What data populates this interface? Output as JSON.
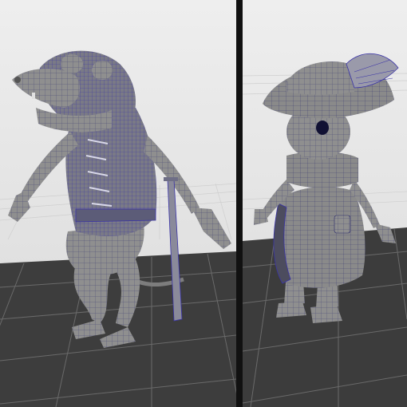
{
  "scene": {
    "divider_color": "#111111",
    "background_top": "#ececec",
    "background_bottom": "#dcdcdc",
    "floor_color": "#3c3c3c",
    "floor_grid_color": "#6a6a6a",
    "sky_grid_color": "#c9c9c9",
    "mesh_fill": "#8c8c8c",
    "mesh_shadow": "#6e6e6e",
    "wire_color": "#2b2b6b",
    "highlight_wire_color": "#4a3fb8"
  },
  "panels": [
    {
      "subject": "rat-warrior-model",
      "pose": "hunched-standing",
      "prop": "sword"
    },
    {
      "subject": "mouse-musketeer-model",
      "pose": "standing",
      "prop": "feathered-hat"
    }
  ]
}
